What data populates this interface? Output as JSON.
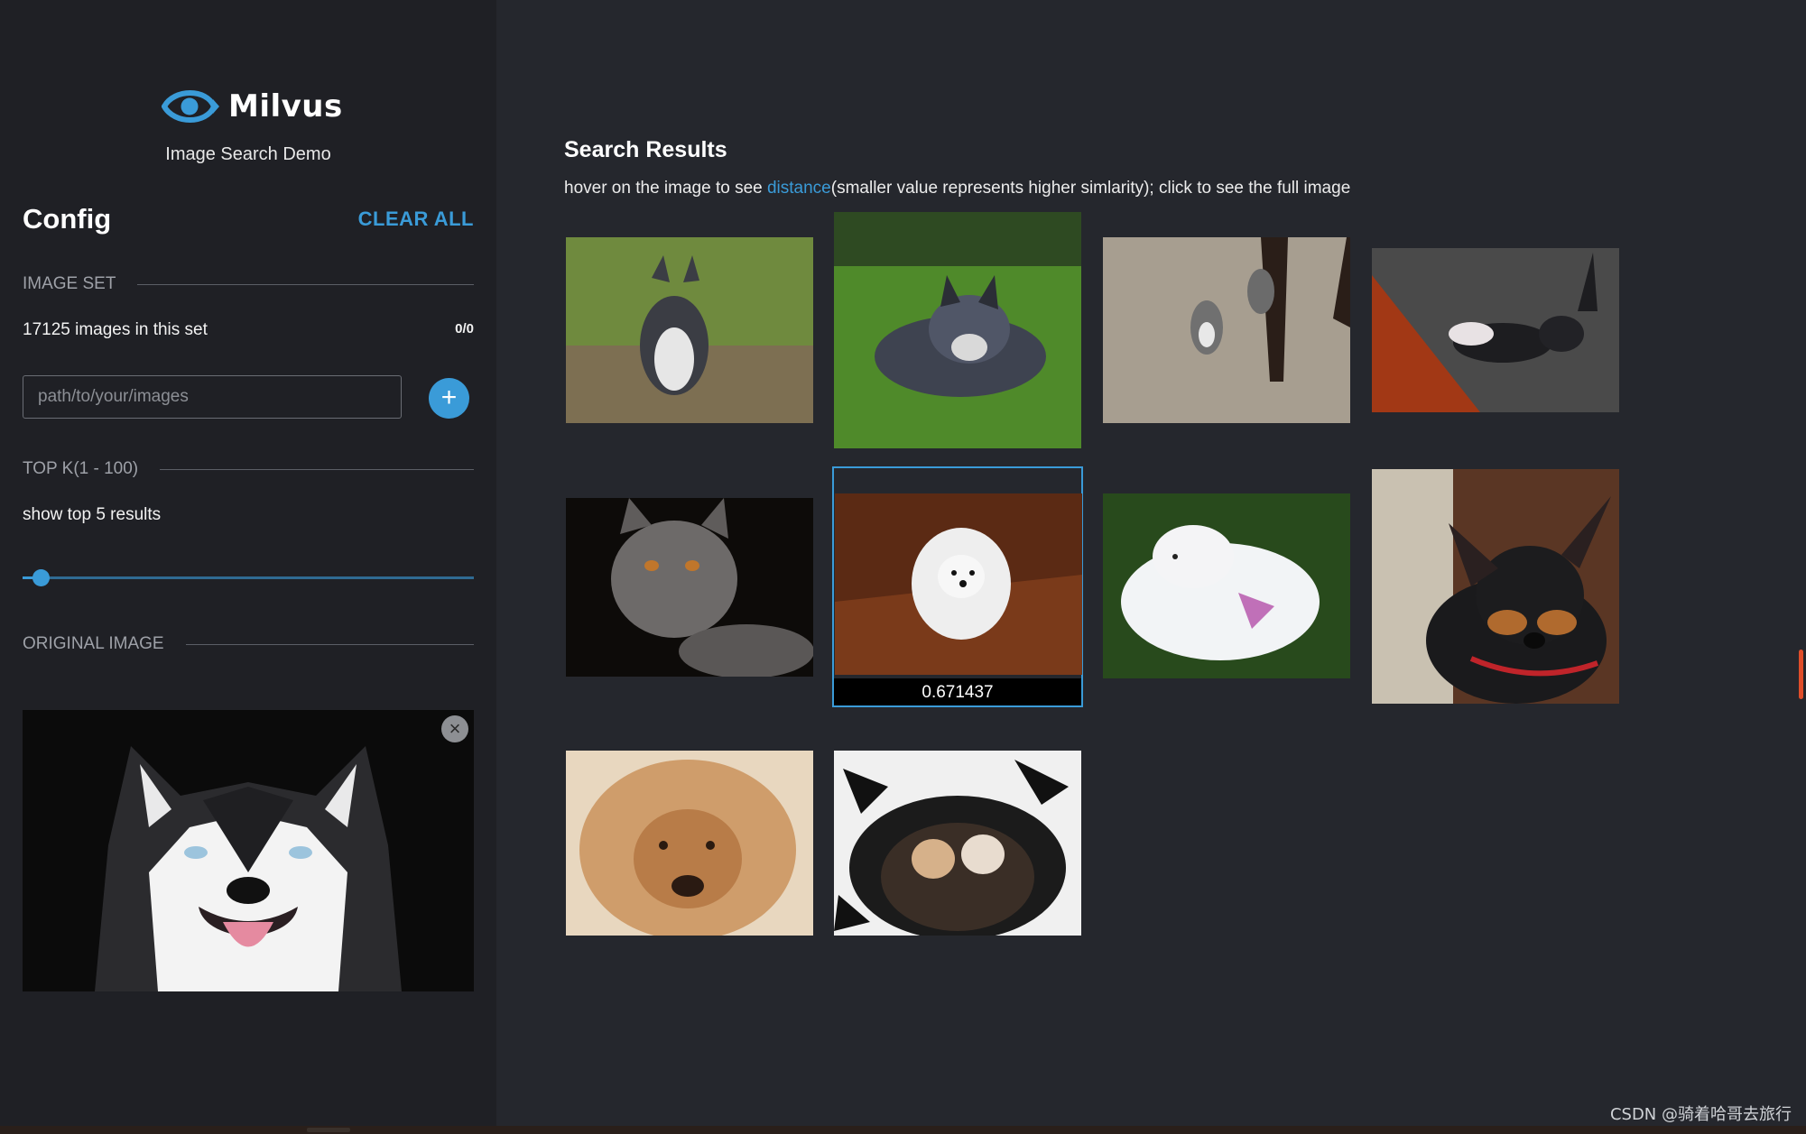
{
  "sidebar": {
    "brand_name": "Milvus",
    "subtitle": "Image Search Demo",
    "config_title": "Config",
    "clear_all": "CLEAR ALL",
    "image_set": {
      "section_label": "IMAGE SET",
      "count_text": "17125 images in this set",
      "progress": "0/0",
      "path_placeholder": "path/to/your/images",
      "add_button_label": "+"
    },
    "top_k": {
      "section_label": "TOP K(1 - 100)",
      "text": "show top 5 results",
      "value": 5,
      "min": 1,
      "max": 100
    },
    "original_image": {
      "section_label": "ORIGINAL IMAGE",
      "subject": "husky-face",
      "close_label": "×"
    }
  },
  "results": {
    "title": "Search Results",
    "hint_before": "hover on the image to see ",
    "hint_link": "distance",
    "hint_after": "(smaller value represents higher simlarity); click to see the full image",
    "items": [
      {
        "subject": "husky on grass",
        "active": false
      },
      {
        "subject": "heeler lying on grass",
        "active": false
      },
      {
        "subject": "two husky puppies by chair",
        "active": false
      },
      {
        "subject": "husky puppy playing",
        "active": false
      },
      {
        "subject": "gray cat",
        "active": false
      },
      {
        "subject": "white spitz on wood floor",
        "active": true,
        "distance": "0.671437"
      },
      {
        "subject": "white dog on grass",
        "active": false
      },
      {
        "subject": "black and tan terrier",
        "active": false
      },
      {
        "subject": "chow chow face",
        "active": false
      },
      {
        "subject": "two kittens in basket",
        "active": false
      }
    ]
  },
  "colors": {
    "accent": "#3a9bd8",
    "sidebar_bg": "#1f2025",
    "main_bg": "#25272d"
  },
  "watermark": "CSDN @骑着哈哥去旅行"
}
